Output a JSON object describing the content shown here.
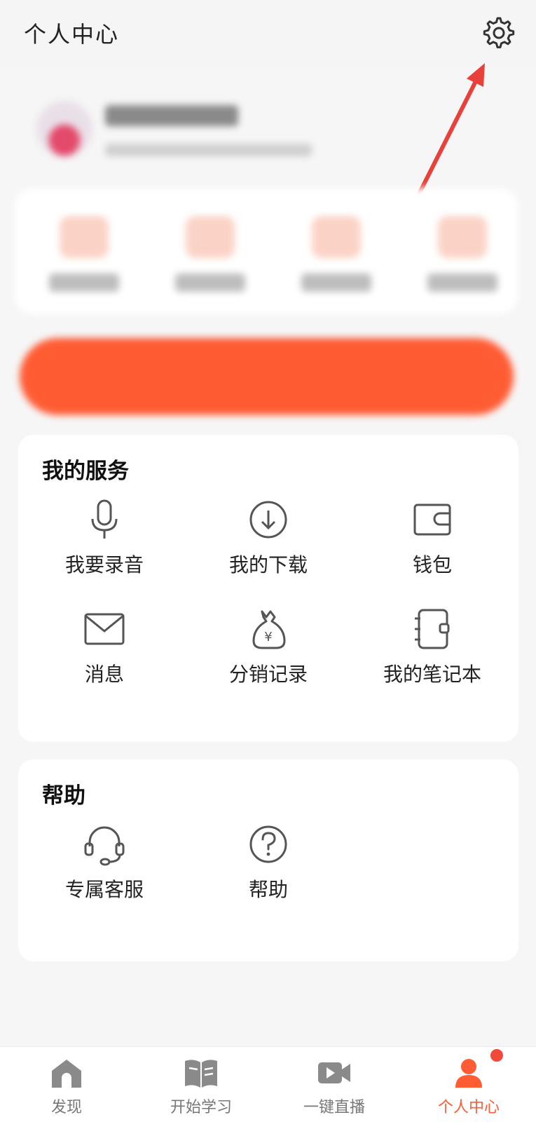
{
  "header": {
    "title": "个人中心",
    "settings_icon": "gear-icon"
  },
  "services": {
    "title": "我的服务",
    "items": [
      {
        "label": "我要录音",
        "icon": "microphone-icon"
      },
      {
        "label": "我的下载",
        "icon": "download-icon"
      },
      {
        "label": "钱包",
        "icon": "wallet-icon"
      },
      {
        "label": "消息",
        "icon": "mail-icon"
      },
      {
        "label": "分销记录",
        "icon": "money-bag-icon"
      },
      {
        "label": "我的笔记本",
        "icon": "notebook-icon"
      }
    ]
  },
  "help": {
    "title": "帮助",
    "items": [
      {
        "label": "专属客服",
        "icon": "headset-icon"
      },
      {
        "label": "帮助",
        "icon": "question-icon"
      }
    ]
  },
  "tabbar": {
    "tabs": [
      {
        "label": "发现",
        "icon": "home-icon"
      },
      {
        "label": "开始学习",
        "icon": "book-icon"
      },
      {
        "label": "一键直播",
        "icon": "video-icon"
      },
      {
        "label": "个人中心",
        "icon": "person-icon",
        "active": true
      }
    ]
  },
  "colors": {
    "accent": "#ff5c34",
    "annotation_arrow": "#e8413b",
    "badge": "#f24a3a"
  }
}
